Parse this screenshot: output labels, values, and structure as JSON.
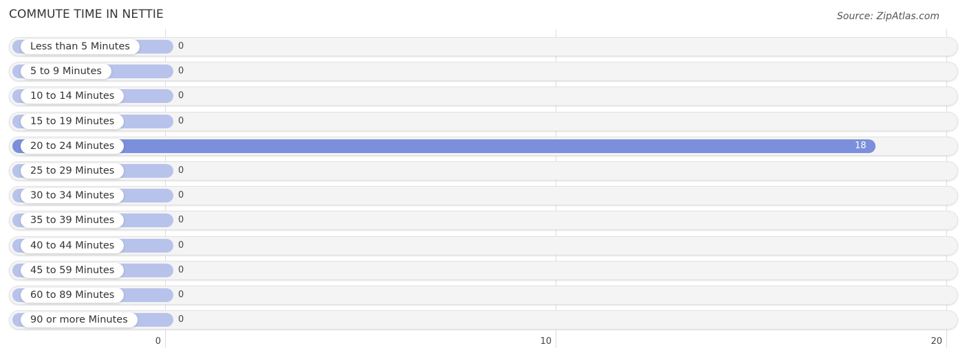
{
  "header": {
    "title": "COMMUTE TIME IN NETTIE",
    "source": "Source: ZipAtlas.com"
  },
  "colors": {
    "bar_zero": "#b8c3eb",
    "bar_highlight": "#7b8fdb",
    "track": "#f4f4f4"
  },
  "chart_data": {
    "type": "bar",
    "orientation": "horizontal",
    "title": "COMMUTE TIME IN NETTIE",
    "xlabel": "",
    "ylabel": "",
    "categories": [
      "Less than 5 Minutes",
      "5 to 9 Minutes",
      "10 to 14 Minutes",
      "15 to 19 Minutes",
      "20 to 24 Minutes",
      "25 to 29 Minutes",
      "30 to 34 Minutes",
      "35 to 39 Minutes",
      "40 to 44 Minutes",
      "45 to 59 Minutes",
      "60 to 89 Minutes",
      "90 or more Minutes"
    ],
    "values": [
      0,
      0,
      0,
      0,
      18,
      0,
      0,
      0,
      0,
      0,
      0,
      0
    ],
    "value_labels": [
      "0",
      "0",
      "0",
      "0",
      "18",
      "0",
      "0",
      "0",
      "0",
      "0",
      "0",
      "0"
    ],
    "xlim": [
      0,
      20
    ],
    "xticks": [
      0,
      10,
      20
    ],
    "xtick_labels": [
      "0",
      "10",
      "20"
    ],
    "grid": true,
    "legend": "none"
  }
}
